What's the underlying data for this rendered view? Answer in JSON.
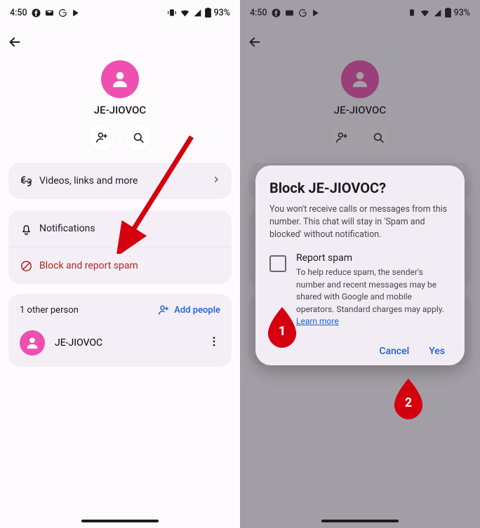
{
  "status": {
    "time": "4:50",
    "battery": "93%"
  },
  "contact": {
    "name": "JE-JIOVOC"
  },
  "rows": {
    "videos": "Videos, links and more",
    "notifications": "Notifications",
    "block": "Block and report spam"
  },
  "people": {
    "header": "1 other person",
    "add": "Add people",
    "member": "JE-JIOVOC"
  },
  "dialog": {
    "title": "Block JE-JIOVOC?",
    "body": "You won't receive calls or messages from this number. This chat will stay in 'Spam and blocked' without notification.",
    "report_title": "Report spam",
    "report_body": "To help reduce spam, the sender's number and recent messages may be shared with Google and mobile operators. Standard charges may apply. ",
    "learn": "Learn more",
    "cancel": "Cancel",
    "yes": "Yes"
  },
  "callouts": {
    "one": "1",
    "two": "2"
  }
}
